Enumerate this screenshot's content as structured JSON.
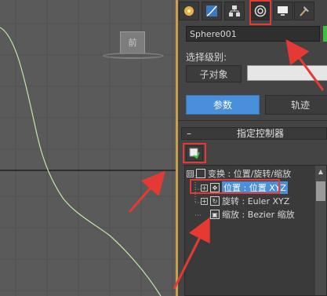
{
  "viewport": {
    "viewcube_label": "前"
  },
  "command_panel": {
    "tabs": [
      {
        "name": "create",
        "icon": "create-icon"
      },
      {
        "name": "modify",
        "icon": "modify-icon"
      },
      {
        "name": "hierarchy",
        "icon": "hierarchy-icon"
      },
      {
        "name": "motion",
        "icon": "motion-icon",
        "active": true
      },
      {
        "name": "display",
        "icon": "display-icon"
      },
      {
        "name": "utilities",
        "icon": "utilities-icon"
      }
    ],
    "object_name": "Sphere001",
    "object_color": "#3fbf3f",
    "selection_level_label": "选择级别:",
    "subobject_button": "子对象",
    "parameters_button": "参数",
    "trajectory_button": "轨迹",
    "rollout_title": "指定控制器",
    "rollout_toggle": "–",
    "controller_tree": [
      {
        "label": "变换 : 位置/旋转/缩放",
        "expander": "⊟"
      },
      {
        "label": "位置 : 位置 XYZ",
        "expander": "+",
        "selected": true
      },
      {
        "label": "旋转 : Euler XYZ",
        "expander": "+"
      },
      {
        "label": "缩放 : Bezier 缩放",
        "expander": ""
      }
    ]
  },
  "colors": {
    "highlight_red": "#e53a33",
    "selection_blue": "#4a8fd9",
    "curve_green": "#bfe8a6"
  }
}
